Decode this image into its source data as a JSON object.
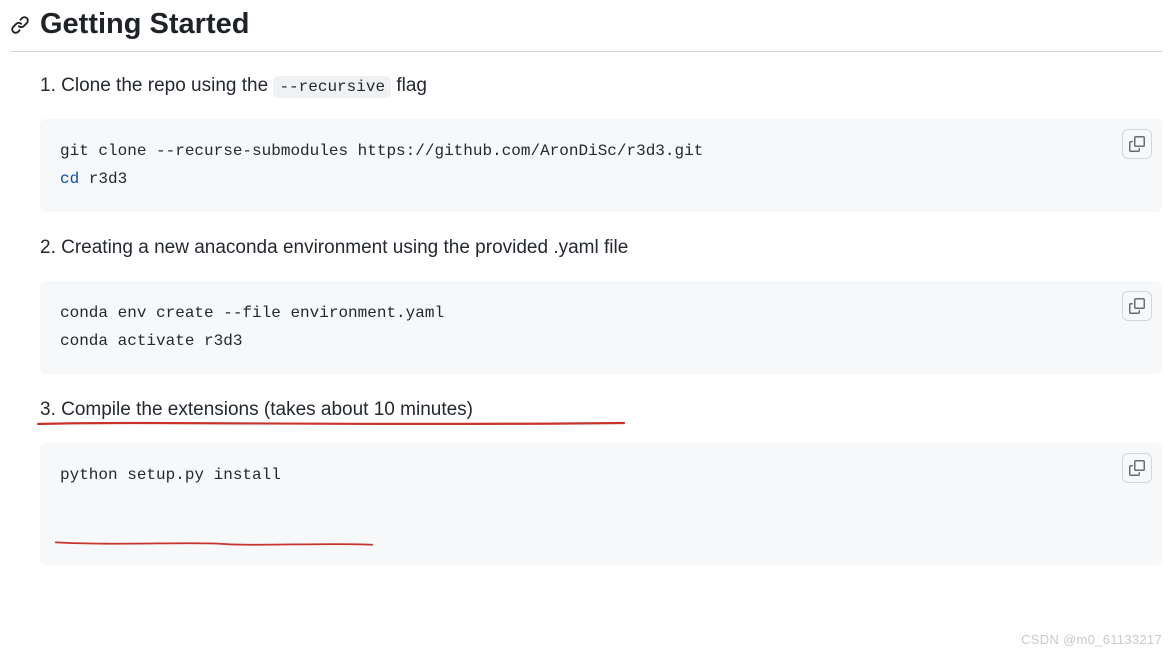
{
  "heading": "Getting Started",
  "steps": [
    {
      "num": "1",
      "label_parts": {
        "before": "1. Clone the repo using the ",
        "code": "--recursive",
        "after": " flag"
      },
      "code_lines": [
        {
          "prefix": "",
          "keyword": "",
          "text": "git clone --recurse-submodules https://github.com/AronDiSc/r3d3.git"
        },
        {
          "keyword": "cd",
          "rest": " r3d3"
        }
      ]
    },
    {
      "num": "2",
      "label": "2. Creating a new anaconda environment using the provided .yaml file",
      "code_lines": [
        {
          "text": "conda env create --file environment.yaml"
        },
        {
          "text": "conda activate r3d3"
        }
      ]
    },
    {
      "num": "3",
      "label": "3. Compile the extensions (takes about 10 minutes)",
      "code_lines": [
        {
          "text": "python setup.py install"
        }
      ]
    }
  ],
  "watermark": "CSDN @m0_61133217",
  "colors": {
    "annotation_red": "#c8332b"
  }
}
